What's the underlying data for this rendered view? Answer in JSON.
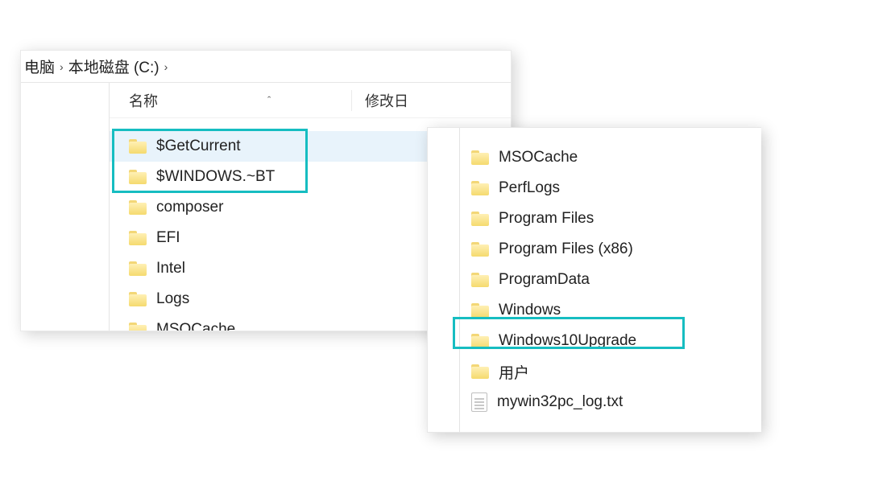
{
  "colors": {
    "highlight": "#16bdc1",
    "selection_bg": "#e8f3fb"
  },
  "left_window": {
    "breadcrumb": {
      "segments": [
        "电脑",
        "本地磁盘 (C:)"
      ],
      "separator": "›"
    },
    "columns": {
      "name": "名称",
      "date": "修改日"
    },
    "items": [
      {
        "type": "folder",
        "name": "$GetCurrent",
        "selected": true,
        "highlighted": true
      },
      {
        "type": "folder",
        "name": "$WINDOWS.~BT",
        "selected": false,
        "highlighted": true
      },
      {
        "type": "folder",
        "name": "composer",
        "selected": false,
        "highlighted": false
      },
      {
        "type": "folder",
        "name": "EFI",
        "selected": false,
        "highlighted": false
      },
      {
        "type": "folder",
        "name": "Intel",
        "selected": false,
        "highlighted": false
      },
      {
        "type": "folder",
        "name": "Logs",
        "selected": false,
        "highlighted": false
      },
      {
        "type": "folder",
        "name": "MSOCache",
        "selected": false,
        "highlighted": false
      }
    ]
  },
  "right_window": {
    "items": [
      {
        "type": "folder",
        "name": "MSOCache",
        "highlighted": false
      },
      {
        "type": "folder",
        "name": "PerfLogs",
        "highlighted": false
      },
      {
        "type": "folder",
        "name": "Program Files",
        "highlighted": false
      },
      {
        "type": "folder",
        "name": "Program Files (x86)",
        "highlighted": false
      },
      {
        "type": "folder",
        "name": "ProgramData",
        "highlighted": false
      },
      {
        "type": "folder",
        "name": "Windows",
        "highlighted": false
      },
      {
        "type": "folder",
        "name": "Windows10Upgrade",
        "highlighted": true
      },
      {
        "type": "folder",
        "name": "用户",
        "highlighted": false
      },
      {
        "type": "file",
        "name": "mywin32pc_log.txt",
        "highlighted": false
      }
    ]
  }
}
